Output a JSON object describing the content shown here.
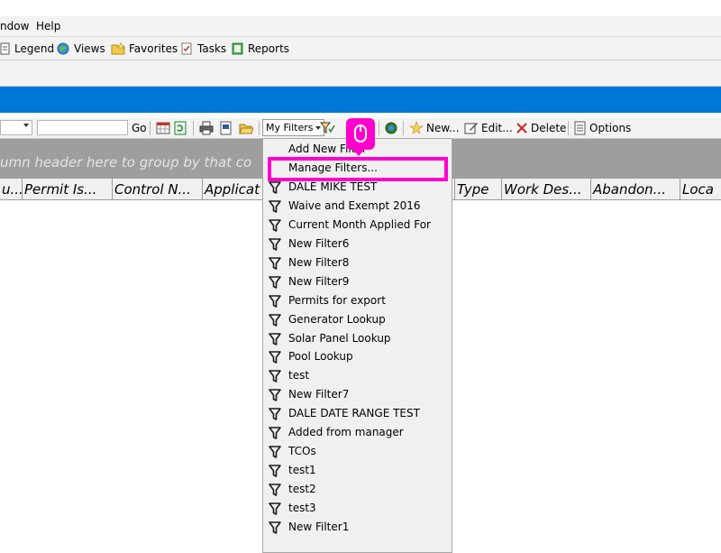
{
  "menubar": {
    "items": [
      "ndow",
      "Help"
    ]
  },
  "toolbar1": {
    "items": [
      {
        "name": "legend",
        "label": "Legend"
      },
      {
        "name": "views",
        "label": "Views"
      },
      {
        "name": "favorites",
        "label": "Favorites"
      },
      {
        "name": "tasks",
        "label": "Tasks"
      },
      {
        "name": "reports",
        "label": "Reports"
      }
    ]
  },
  "toolbar2": {
    "go_label": "Go",
    "myfilters_label": "My Filters",
    "new_label": "New...",
    "edit_label": "Edit...",
    "delete_label": "Delete",
    "options_label": "Options"
  },
  "grid": {
    "group_hint": "umn header here to group by that co",
    "columns": [
      "u...",
      "Permit Is...",
      "Control N...",
      "Applicat",
      "",
      "Type",
      "Work Des...",
      "Abandon...",
      "Loca"
    ]
  },
  "dropdown": {
    "items": [
      "Add New Filter",
      "Manage Filters...",
      "DALE MIKE TEST",
      "Waive and Exempt 2016",
      "Current Month Applied For",
      "New Filter6",
      "New Filter8",
      "New Filter9",
      "Permits for export",
      "Generator Lookup",
      "Solar Panel Lookup",
      "Pool Lookup",
      "test",
      "New Filter7",
      "DALE DATE RANGE TEST",
      "Added from manager",
      "TCOs",
      "test1",
      "test2",
      "test3",
      "New Filter1"
    ]
  },
  "colors": {
    "highlight": "#ff00cc",
    "blue_bar": "#0078d7",
    "group_bar": "#9e9e9e"
  }
}
